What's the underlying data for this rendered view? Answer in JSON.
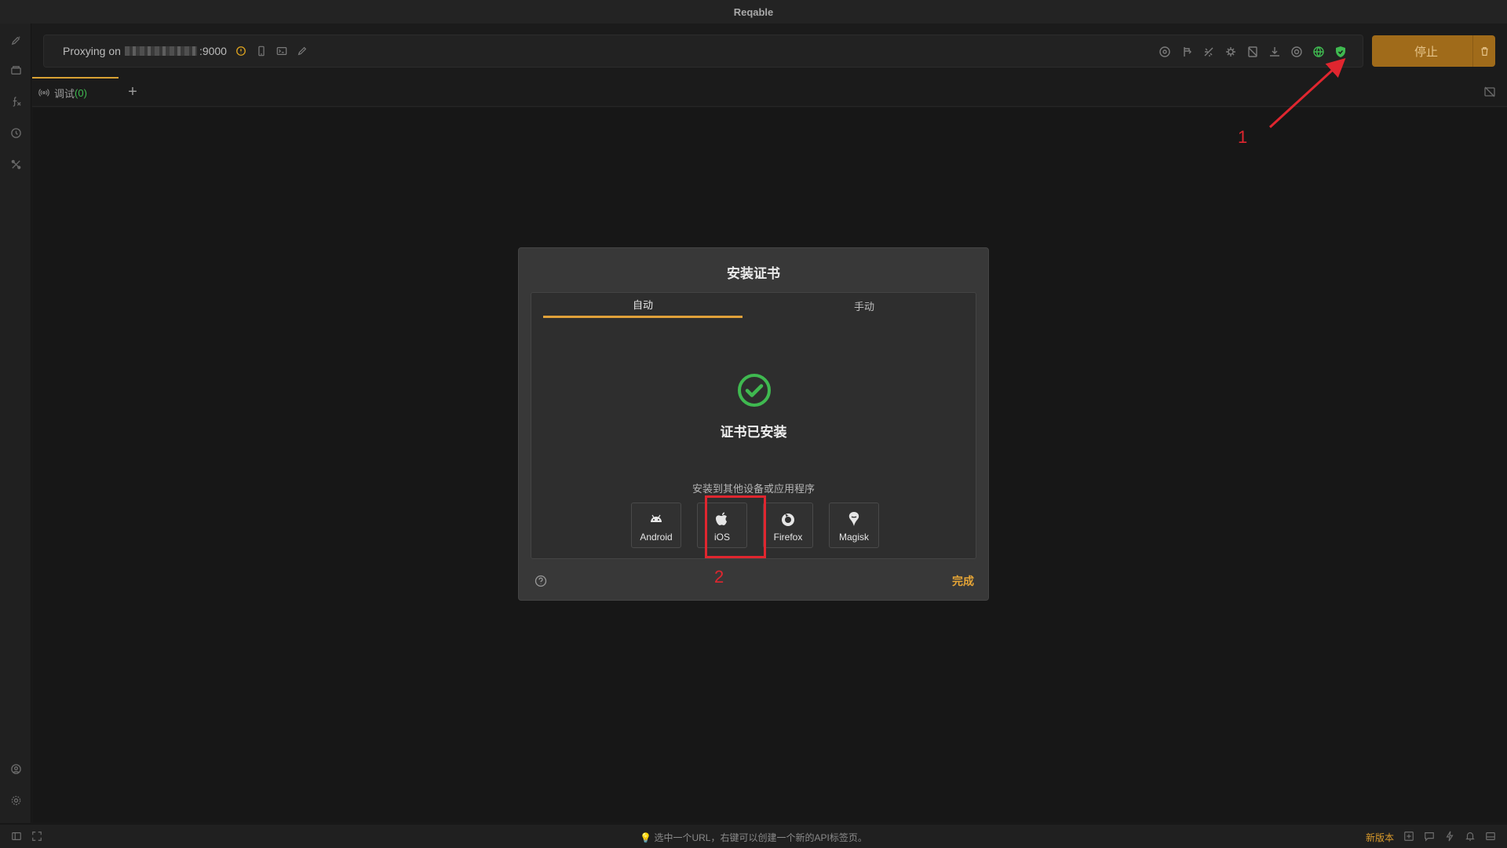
{
  "app": {
    "title": "Reqable"
  },
  "proxy": {
    "label": "Proxying on",
    "port": ":9000"
  },
  "actions": {
    "stop_label": "停止"
  },
  "tabs": [
    {
      "label": "调试",
      "count": "(0)"
    }
  ],
  "dialog": {
    "title": "安装证书",
    "tabs": {
      "auto": "自动",
      "manual": "手动"
    },
    "status_text": "证书已安装",
    "install_other_label": "安装到其他设备或应用程序",
    "platforms": [
      {
        "label": "Android",
        "icon": "android-icon"
      },
      {
        "label": "iOS",
        "icon": "apple-icon"
      },
      {
        "label": "Firefox",
        "icon": "firefox-icon"
      },
      {
        "label": "Magisk",
        "icon": "magisk-icon"
      }
    ],
    "done_label": "完成"
  },
  "annotations": {
    "marker_1": "1",
    "marker_2": "2",
    "color": "#e0262f"
  },
  "statusbar": {
    "hint": "选中一个URL，右键可以创建一个新的API标签页。",
    "new_version": "新版本"
  },
  "colors": {
    "accent": "#e0a13a",
    "success": "#3fb950",
    "stop_button": "#a06b1a"
  }
}
